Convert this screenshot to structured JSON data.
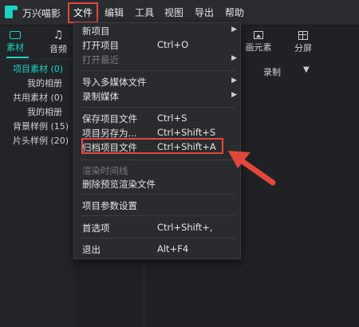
{
  "app": {
    "title": "万兴喵影"
  },
  "menubar": [
    "文件",
    "编辑",
    "工具",
    "视图",
    "导出",
    "帮助"
  ],
  "left_tabs": [
    {
      "label": "素材"
    },
    {
      "label": "音频"
    }
  ],
  "tree": [
    "项目素材 (0)",
    "我的相册",
    "共用素材 (0)",
    "我的相册",
    "背景样例 (15)",
    "片头样例 (20)"
  ],
  "right_tools": [
    "画元素",
    "分屏"
  ],
  "record_label": "录制",
  "file_menu": {
    "items": [
      {
        "label": "新项目",
        "shortcut": "",
        "submenu": true,
        "disabled": false
      },
      {
        "label": "打开项目",
        "shortcut": "Ctrl+O",
        "submenu": false,
        "disabled": false
      },
      {
        "label": "打开最近",
        "shortcut": "",
        "submenu": true,
        "disabled": true
      },
      {
        "label": "导入多媒体文件",
        "shortcut": "",
        "submenu": true,
        "disabled": false
      },
      {
        "label": "录制媒体",
        "shortcut": "",
        "submenu": true,
        "disabled": false
      },
      {
        "label": "保存项目文件",
        "shortcut": "Ctrl+S",
        "submenu": false,
        "disabled": false
      },
      {
        "label": "项目另存为...",
        "shortcut": "Ctrl+Shift+S",
        "submenu": false,
        "disabled": false
      },
      {
        "label": "归档项目文件",
        "shortcut": "Ctrl+Shift+A",
        "submenu": false,
        "disabled": false
      },
      {
        "label": "渲染时间线",
        "shortcut": "",
        "submenu": false,
        "disabled": true
      },
      {
        "label": "删除预览渲染文件",
        "shortcut": "",
        "submenu": false,
        "disabled": false
      },
      {
        "label": "项目参数设置",
        "shortcut": "",
        "submenu": false,
        "disabled": false
      },
      {
        "label": "首选项",
        "shortcut": "Ctrl+Shift+,",
        "submenu": false,
        "disabled": false
      },
      {
        "label": "退出",
        "shortcut": "Alt+F4",
        "submenu": false,
        "disabled": false
      }
    ],
    "highlighted": "归档项目文件"
  },
  "colors": {
    "accent": "#19d3c5",
    "highlight": "#e3473c"
  }
}
